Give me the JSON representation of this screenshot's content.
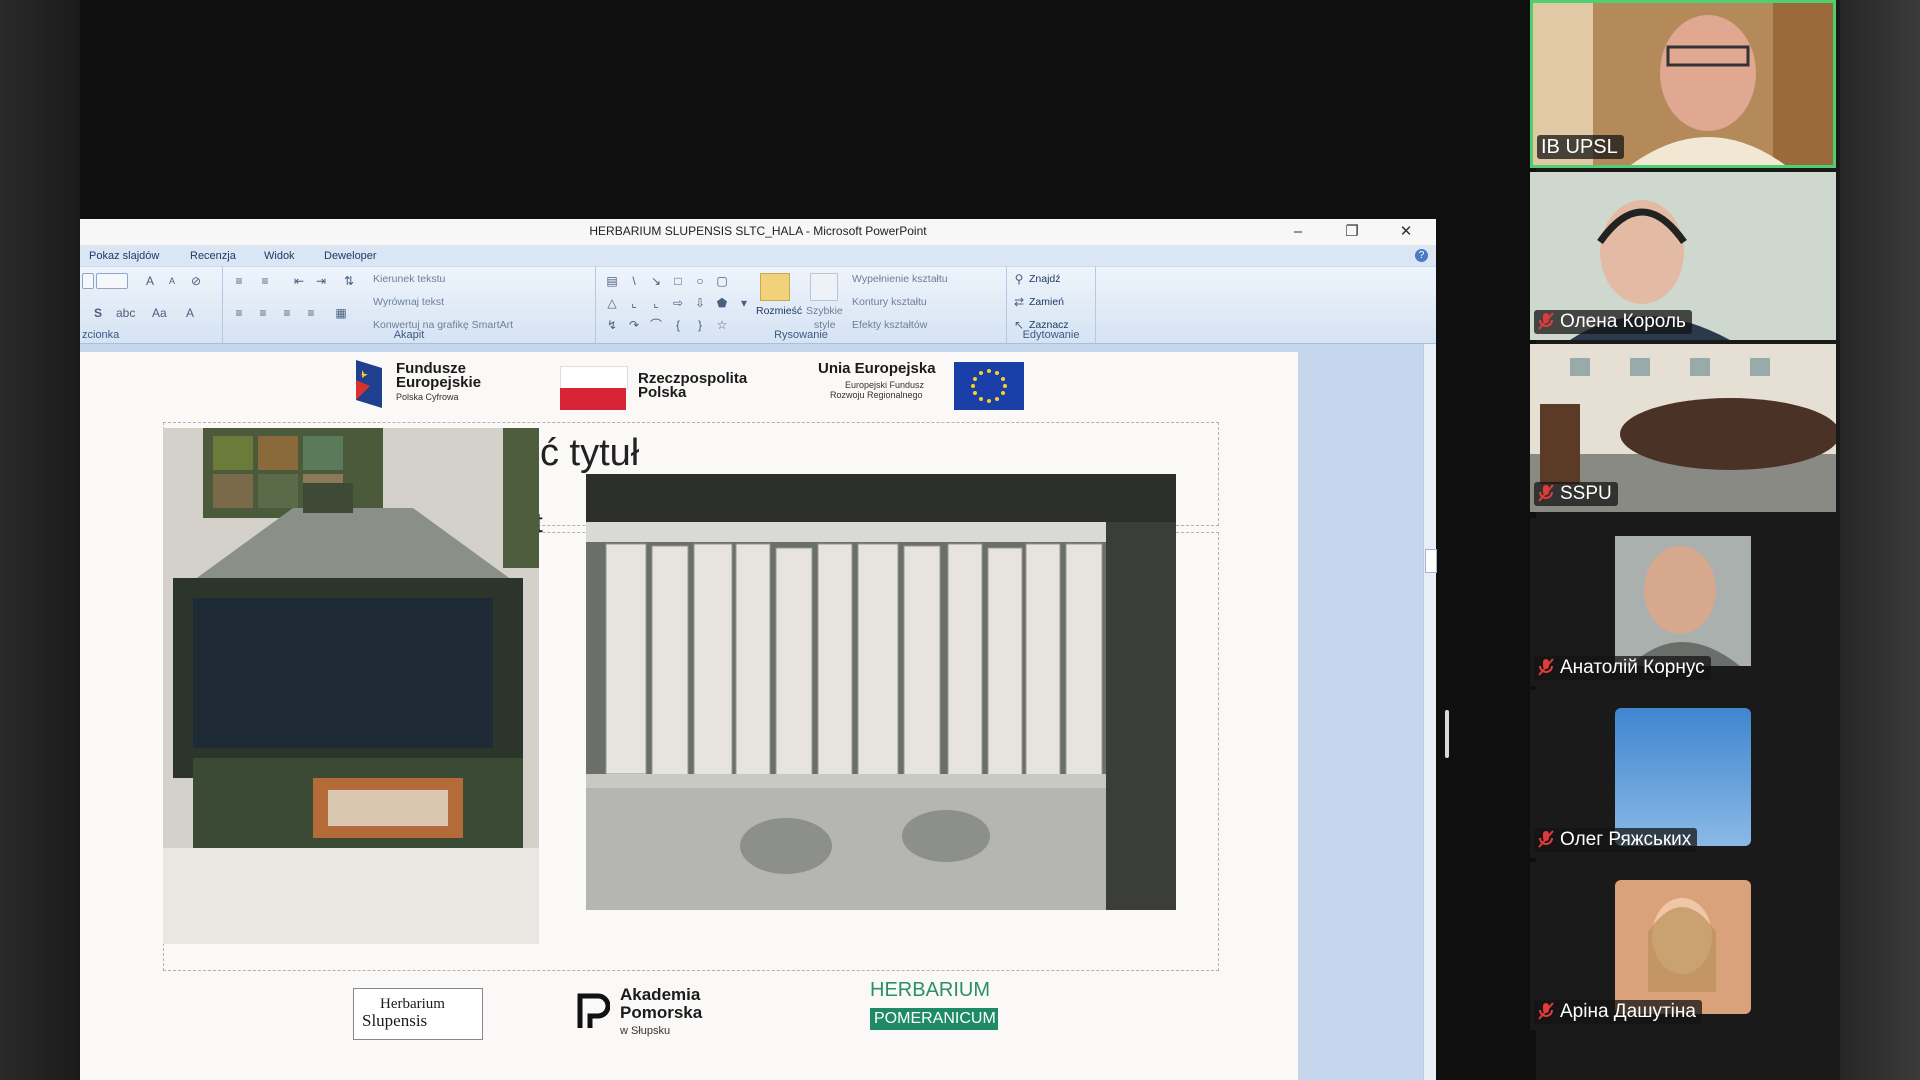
{
  "window": {
    "title": "HERBARIUM SLUPENSIS SLTC_HALA - Microsoft PowerPoint"
  },
  "menu": [
    "Pokaz slajdów",
    "Recenzja",
    "Widok",
    "Deweloper"
  ],
  "ribbon": {
    "groups": {
      "czcionka": "zcionka",
      "akapit": "Akapit",
      "rysowanie": "Rysowanie",
      "edytowanie": "Edytowanie"
    },
    "akapit_items": [
      "Kierunek tekstu",
      "Wyrównaj tekst",
      "Konwertuj na grafikę SmartArt"
    ],
    "rysowanie_items": {
      "rozmiesc": "Rozmieść",
      "szybkie_style": [
        "Szybkie",
        "style"
      ],
      "wypelnienie": "Wypełnienie kształtu",
      "kontury": "Kontury kształtu",
      "efekty": "Efekty kształtów"
    },
    "edytowanie_items": [
      "Znajdź",
      "Zamień",
      "Zaznacz"
    ]
  },
  "slide": {
    "top_logos": {
      "fe_title": [
        "Fundusze",
        "Europejskie"
      ],
      "fe_sub": "Polska Cyfrowa",
      "rp_title": [
        "Rzeczpospolita",
        "Polska"
      ],
      "ue_title": "Unia Europejska",
      "ue_sub": [
        "Europejski Fundusz",
        "Rozwoju Regionalnego"
      ]
    },
    "ghost_title": "ć tytuł",
    "ghost_text": "t",
    "bottom_logos": {
      "herbarium_slupensis": [
        "Herbarium",
        "Slupensis"
      ],
      "akademia": [
        "Akademia",
        "Pomorska",
        "w Słupsku"
      ],
      "herbarium_pom": [
        "HERBARIUM",
        "POMERANICUM"
      ]
    }
  },
  "participants": [
    {
      "name": "IB UPSL",
      "muted": false,
      "active": true
    },
    {
      "name": "Олена Король",
      "muted": true,
      "active": false
    },
    {
      "name": "SSPU",
      "muted": true,
      "active": false
    },
    {
      "name": "Анатолій Корнус",
      "muted": true,
      "active": false
    },
    {
      "name": "Олег Ряжських",
      "muted": true,
      "active": false
    },
    {
      "name": "Аріна Дашутіна",
      "muted": true,
      "active": false
    }
  ],
  "colors": {
    "active_speaker": "#4fcf6f",
    "mute_icon": "#e03b3b",
    "ribbon_text": "#1f3a63"
  }
}
